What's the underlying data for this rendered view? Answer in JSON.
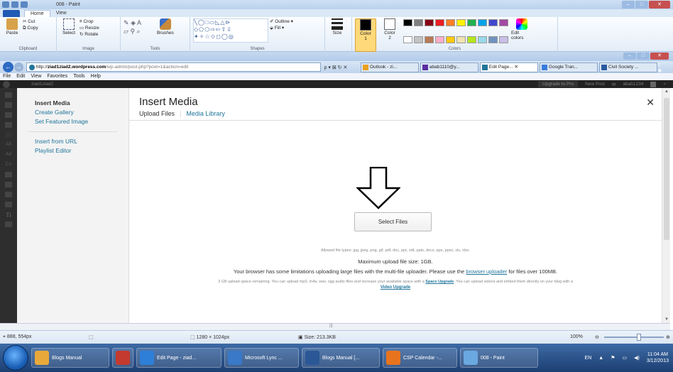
{
  "paint": {
    "title": "008 - Paint",
    "tabs": [
      "Home",
      "View"
    ],
    "clipboard": {
      "paste": "Paste",
      "cut": "Cut",
      "copy": "Copy",
      "group": "Clipboard"
    },
    "image": {
      "select": "Select",
      "crop": "Crop",
      "resize": "Resize",
      "rotate": "Rotate",
      "group": "Image"
    },
    "tools": {
      "group": "Tools",
      "brushes": "Brushes"
    },
    "shapes": {
      "group": "Shapes",
      "outline": "Outline",
      "fill": "Fill"
    },
    "size_label": "Size",
    "colors": {
      "color1": "Color",
      "color1_num": "1",
      "color2": "Color",
      "color2_num": "2",
      "edit": "Edit colors",
      "group": "Colors",
      "palette": [
        "#000000",
        "#7f7f7f",
        "#880015",
        "#ed1c24",
        "#ff7f27",
        "#fff200",
        "#22b14c",
        "#00a2e8",
        "#3f48cc",
        "#a349a4",
        "#ffffff",
        "#c3c3c3",
        "#b97a57",
        "#ffaec9",
        "#ffc90e",
        "#efe4b0",
        "#b5e61d",
        "#99d9ea",
        "#7092be",
        "#c8bfe7"
      ]
    },
    "status": {
      "cursor": "888, 554px",
      "dimensions": "1280 × 1024px",
      "size": "Size: 213.3KB",
      "zoom": "100%",
      "zoom_level": 0.58
    }
  },
  "browser": {
    "address": {
      "prefix": "http://",
      "host_bold": "ziad1ziad2.wordpress.com",
      "path": "/wp-admin/post.php?post=1&action=edit"
    },
    "tabs": [
      {
        "label": "Outlook - zi...",
        "color": "#e8a020"
      },
      {
        "label": "abab1110@y...",
        "color": "#5a2fa0"
      },
      {
        "label": "Edit Page...",
        "color": "#21759b",
        "active": true
      },
      {
        "label": "Google Tran...",
        "color": "#3b7ddd"
      },
      {
        "label": "Civil Society ...",
        "color": "#2b5aa0"
      }
    ],
    "menu": [
      "File",
      "Edit",
      "View",
      "Favorites",
      "Tools",
      "Help"
    ]
  },
  "wp_bar": {
    "site": "ziad1ziad2",
    "upgrade": "Upgrade to Pro",
    "new_post": "New Post",
    "user": "abab1234"
  },
  "admin_side_labels": [
    "All",
    "Ad",
    "Co",
    "Ti"
  ],
  "modal": {
    "title": "Insert Media",
    "sidebar": {
      "active": "Insert Media",
      "gallery": "Create Gallery",
      "featured": "Set Featured Image",
      "url": "Insert from URL",
      "playlist": "Playlist Editor"
    },
    "tabs": {
      "upload": "Upload Files",
      "library": "Media Library"
    },
    "select_files": "Select Files",
    "allowed": "Allowed file types: jpg, jpeg, png, gif, pdf, doc, ppt, odt, pptx, docx, pps, ppsx, xls, xlsx.",
    "max_size": "Maximum upload file size: 1GB.",
    "limits_pre": "Your browser has some limitations uploading large files with the multi-file uploader. Please use the",
    "limits_link": "browser uploader",
    "limits_post": "for files over 100MB.",
    "space_pre": "3 GB upload space remaining. You can upload mp3, m4a, wav, ogg audio files and increase your available space with a",
    "space_link": "Space Upgrade",
    "space_post": ". You can upload videos and embed them directly on your blog with a",
    "video_link": "Video Upgrade"
  },
  "taskbar": {
    "items": [
      {
        "label": "Blogs Manual",
        "color": "#e8a93a"
      },
      {
        "label": "",
        "color": "#c43a2e"
      },
      {
        "label": "Edit Page - ziad...",
        "color": "#2e7fd8"
      },
      {
        "label": "Microsoft Lync ...",
        "color": "#3a78c8"
      },
      {
        "label": "Blogs Manual [...",
        "color": "#2b5797"
      },
      {
        "label": "CSP Calendar -...",
        "color": "#e8731e"
      },
      {
        "label": "008 - Paint",
        "color": "#6aa8e0"
      }
    ],
    "lang": "EN",
    "time": "11:04 AM",
    "date": "3/12/2013"
  }
}
